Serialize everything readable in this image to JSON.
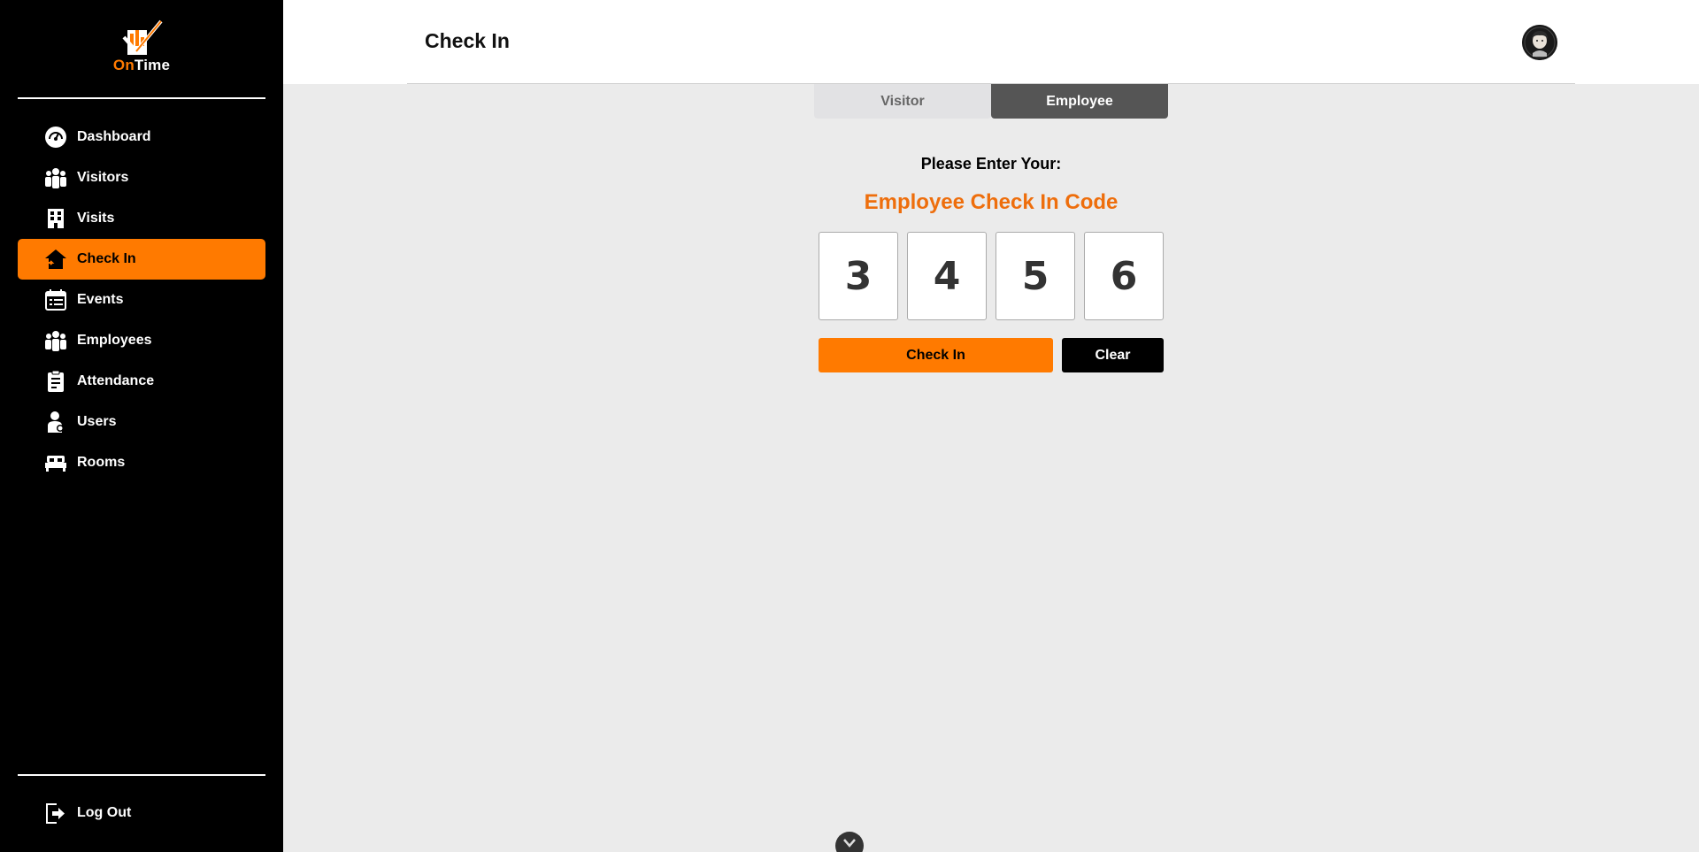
{
  "brand": {
    "on": "On",
    "time": "Time",
    "accent": "#ff7a00"
  },
  "sidebar": {
    "items": [
      {
        "label": "Dashboard",
        "icon": "gauge-icon"
      },
      {
        "label": "Visitors",
        "icon": "group-icon"
      },
      {
        "label": "Visits",
        "icon": "building-icon"
      },
      {
        "label": "Check In",
        "icon": "house-enter-icon",
        "active": true
      },
      {
        "label": "Events",
        "icon": "calendar-icon"
      },
      {
        "label": "Employees",
        "icon": "team-icon"
      },
      {
        "label": "Attendance",
        "icon": "clipboard-icon"
      },
      {
        "label": "Users",
        "icon": "user-gear-icon"
      },
      {
        "label": "Rooms",
        "icon": "bed-icon"
      }
    ],
    "logout": {
      "label": "Log Out",
      "icon": "logout-icon"
    }
  },
  "header": {
    "title": "Check In",
    "avatar_icon": "user-avatar"
  },
  "tabs": [
    {
      "label": "Visitor",
      "active": false
    },
    {
      "label": "Employee",
      "active": true
    }
  ],
  "form": {
    "prompt": "Please Enter Your:",
    "code_title": "Employee Check In Code",
    "digits": [
      "3",
      "4",
      "5",
      "6"
    ],
    "checkin_label": "Check In",
    "clear_label": "Clear"
  },
  "scroll_icon": "chevron-down-icon"
}
